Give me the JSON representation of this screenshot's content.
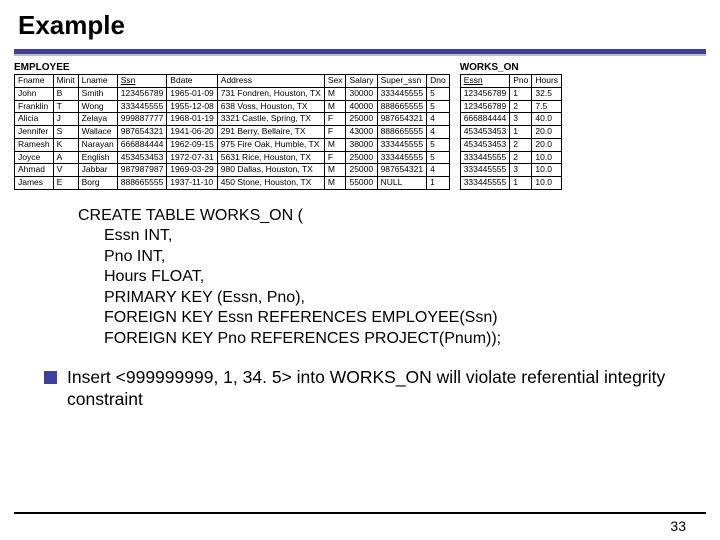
{
  "title": "Example",
  "employee": {
    "caption": "EMPLOYEE",
    "headers": [
      "Fname",
      "Minit",
      "Lname",
      "Ssn",
      "Bdate",
      "Address",
      "Sex",
      "Salary",
      "Super_ssn",
      "Dno"
    ],
    "rows": [
      [
        "John",
        "B",
        "Smith",
        "123456789",
        "1965-01-09",
        "731 Fondren, Houston, TX",
        "M",
        "30000",
        "333445555",
        "5"
      ],
      [
        "Franklin",
        "T",
        "Wong",
        "333445555",
        "1955-12-08",
        "638 Voss, Houston, TX",
        "M",
        "40000",
        "888665555",
        "5"
      ],
      [
        "Alicia",
        "J",
        "Zelaya",
        "999887777",
        "1968-01-19",
        "3321 Castle, Spring, TX",
        "F",
        "25000",
        "987654321",
        "4"
      ],
      [
        "Jennifer",
        "S",
        "Wallace",
        "987654321",
        "1941-06-20",
        "291 Berry, Bellaire, TX",
        "F",
        "43000",
        "888665555",
        "4"
      ],
      [
        "Ramesh",
        "K",
        "Narayan",
        "666884444",
        "1962-09-15",
        "975 Fire Oak, Humble, TX",
        "M",
        "38000",
        "333445555",
        "5"
      ],
      [
        "Joyce",
        "A",
        "English",
        "453453453",
        "1972-07-31",
        "5631 Rice, Houston, TX",
        "F",
        "25000",
        "333445555",
        "5"
      ],
      [
        "Ahmad",
        "V",
        "Jabbar",
        "987987987",
        "1969-03-29",
        "980 Dallas, Houston, TX",
        "M",
        "25000",
        "987654321",
        "4"
      ],
      [
        "James",
        "E",
        "Borg",
        "888665555",
        "1937-11-10",
        "450 Stone, Houston, TX",
        "M",
        "55000",
        "NULL",
        "1"
      ]
    ]
  },
  "works_on": {
    "caption": "WORKS_ON",
    "headers": [
      "Essn",
      "Pno",
      "Hours"
    ],
    "rows": [
      [
        "123456789",
        "1",
        "32.5"
      ],
      [
        "123456789",
        "2",
        "7.5"
      ],
      [
        "666884444",
        "3",
        "40.0"
      ],
      [
        "453453453",
        "1",
        "20.0"
      ],
      [
        "453453453",
        "2",
        "20.0"
      ],
      [
        "333445555",
        "2",
        "10.0"
      ],
      [
        "333445555",
        "3",
        "10.0"
      ],
      [
        "333445555",
        "1",
        "10.0"
      ]
    ]
  },
  "sql": {
    "l1": "CREATE TABLE WORKS_ON (",
    "l2": "Essn  INT,",
    "l3": "Pno INT,",
    "l4": "Hours FLOAT,",
    "l5": "PRIMARY KEY (Essn, Pno),",
    "l6": "FOREIGN KEY Essn REFERENCES EMPLOYEE(Ssn)",
    "l7": "FOREIGN KEY Pno REFERENCES PROJECT(Pnum));"
  },
  "bullet": "Insert <999999999, 1, 34. 5> into WORKS_ON will violate referential integrity constraint",
  "page": "33"
}
